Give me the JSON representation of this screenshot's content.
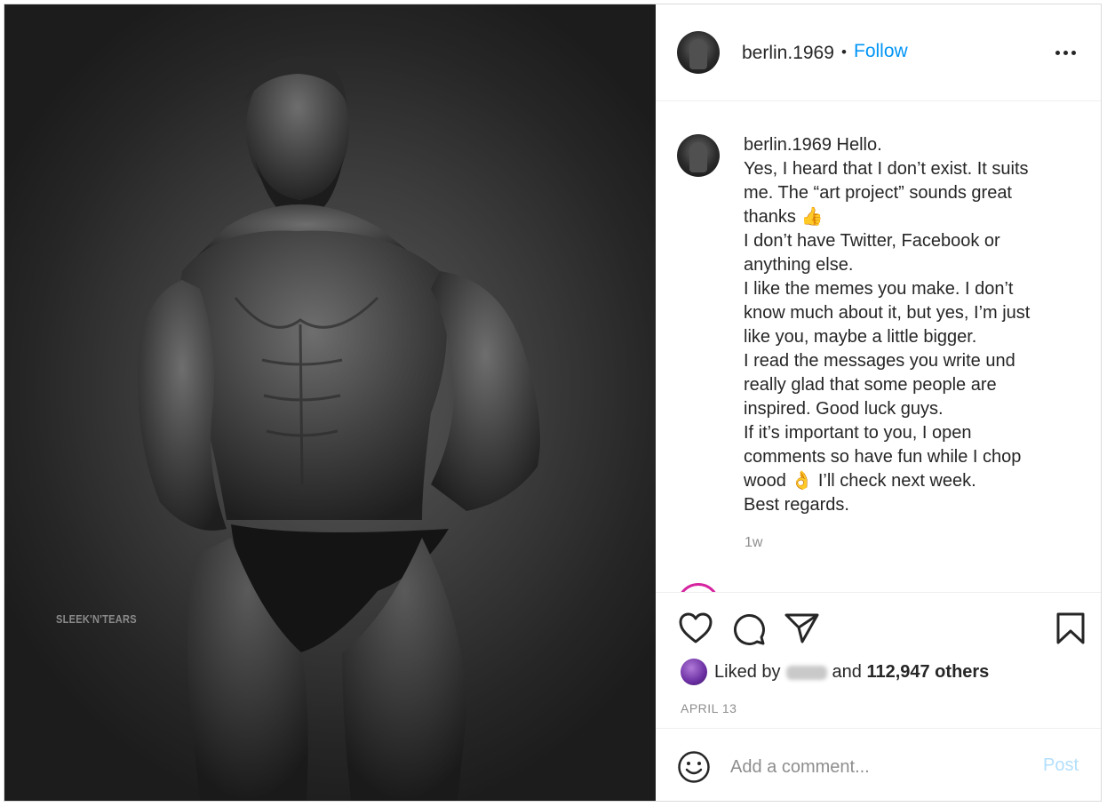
{
  "photo": {
    "watermark": "SLEEK'N'TEARS"
  },
  "header": {
    "username": "berlin.1969",
    "separator": "•",
    "follow_label": "Follow",
    "more_icon": "more-horizontal-icon"
  },
  "caption": {
    "username": "berlin.1969",
    "lines": [
      "Hello.",
      "Yes, I heard that I don’t exist. It suits",
      "me. The “art project” sounds great",
      "thanks 👍",
      "I don’t have Twitter, Facebook or",
      "anything else.",
      "I like the memes you make. I don’t",
      "know much about it, but yes, I’m just",
      "like you, maybe a little bigger.",
      "I read the messages you write und",
      "really glad that some people are",
      "inspired. Good luck guys.",
      "If it’s important to you, I open",
      "comments so have fun while I chop",
      "wood 👌 I’ll check next week.",
      "Best regards."
    ],
    "timestamp": "1w"
  },
  "actions": {
    "like_icon": "heart-icon",
    "comment_icon": "comment-icon",
    "share_icon": "paper-plane-icon",
    "save_icon": "bookmark-icon"
  },
  "likes": {
    "prefix": "Liked by",
    "middle": "and",
    "count_text": "112,947 others"
  },
  "date": "APRIL 13",
  "comment": {
    "emoji_icon": "smiley-icon",
    "placeholder": "Add a comment...",
    "post_label": "Post"
  },
  "colors": {
    "link": "#0095f6",
    "text": "#262626",
    "muted": "#8e8e8e",
    "post_disabled": "#b2dffc",
    "border": "#dbdbdb"
  }
}
